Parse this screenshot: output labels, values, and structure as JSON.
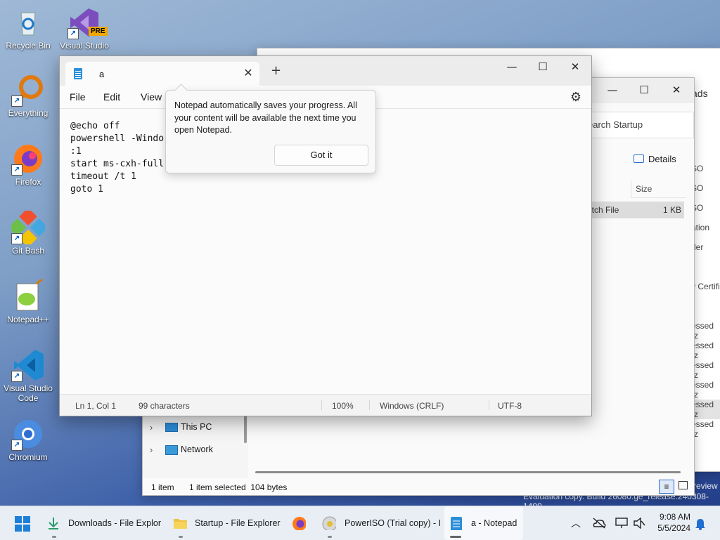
{
  "desktop": {
    "icons": [
      {
        "label": "Recycle Bin",
        "icon": "recycle-bin-icon"
      },
      {
        "label": "Visual Studio",
        "badge": "PRE",
        "icon": "visual-studio-icon"
      },
      {
        "label": "Everything",
        "icon": "everything-icon"
      },
      {
        "label": "Firefox",
        "icon": "firefox-icon"
      },
      {
        "label": "Git Bash",
        "icon": "git-bash-icon"
      },
      {
        "label": "Notepad++",
        "icon": "notepad-plus-plus-icon"
      },
      {
        "label": "Visual Studio Code",
        "icon": "vscode-icon"
      },
      {
        "label": "Chromium",
        "icon": "chromium-icon"
      }
    ],
    "watermark": "Evaluation copy. Build 26080.ge_release.240308-1400",
    "preview_text": "review"
  },
  "explorer_back": {
    "title_hint": "ads",
    "search_placeholder": "earch Startup",
    "details_label": "Details",
    "column_size": "Size",
    "row_type": "atch File",
    "row_size": "1 KB",
    "right_fragments": [
      "SO",
      "SO",
      "SO",
      "ation",
      "der",
      "y Certifi",
      "essed (z",
      "essed (z",
      "essed (z",
      "essed (z",
      "essed (z",
      "essed (z"
    ],
    "nav_items": [
      {
        "label": "This PC",
        "icon": "pc-icon"
      },
      {
        "label": "Network",
        "icon": "network-icon"
      }
    ],
    "status": {
      "items": "1 item",
      "selected": "1 item selected  104 bytes"
    }
  },
  "notepad": {
    "tab_title": "a",
    "new_tab": "+",
    "menu": [
      "File",
      "Edit",
      "View"
    ],
    "lines": [
      "@echo off",
      "powershell -Windo",
      ":1",
      "start ms-cxh-full",
      "timeout /t 1",
      "goto 1"
    ],
    "status": {
      "position": "Ln 1, Col 1",
      "characters": "99 characters",
      "zoom": "100%",
      "line_ending": "Windows (CRLF)",
      "encoding": "UTF-8"
    }
  },
  "popup": {
    "message": "Notepad automatically saves your progress. All your content will be available the next time you open Notepad.",
    "button": "Got it"
  },
  "taskbar": {
    "items": [
      {
        "label": "Downloads - File Explor",
        "icon": "download-icon"
      },
      {
        "label": "Startup - File Explorer",
        "icon": "folder-icon"
      },
      {
        "label": "",
        "icon": "firefox-icon"
      },
      {
        "label": "PowerISO (Trial copy) - I",
        "icon": "poweriso-icon"
      },
      {
        "label": "a - Notepad",
        "icon": "notepad-icon"
      }
    ],
    "time": "9:08 AM",
    "date": "5/5/2024"
  }
}
